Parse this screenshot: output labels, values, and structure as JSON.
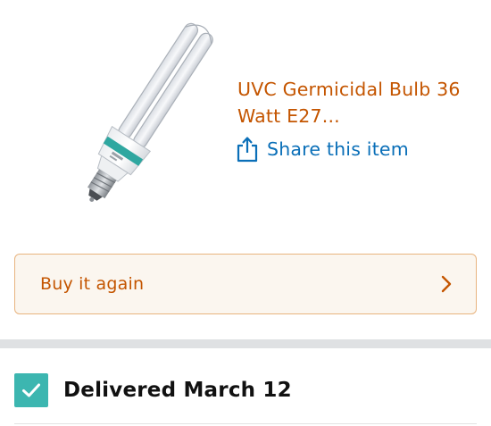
{
  "product": {
    "title": "UVC Germicidal Bulb 36 Watt E27...",
    "image_icon": "uvc-bulb-image"
  },
  "share": {
    "icon": "share-icon",
    "label": "Share this item"
  },
  "buy_again": {
    "label": "Buy it again",
    "icon": "chevron-right-icon"
  },
  "delivery": {
    "status": "Delivered March 12",
    "icon": "checkmark-icon"
  },
  "colors": {
    "title": "#c45500",
    "link": "#0a6fb8",
    "check": "#3cb6b0",
    "button_border": "#e8b47f"
  }
}
